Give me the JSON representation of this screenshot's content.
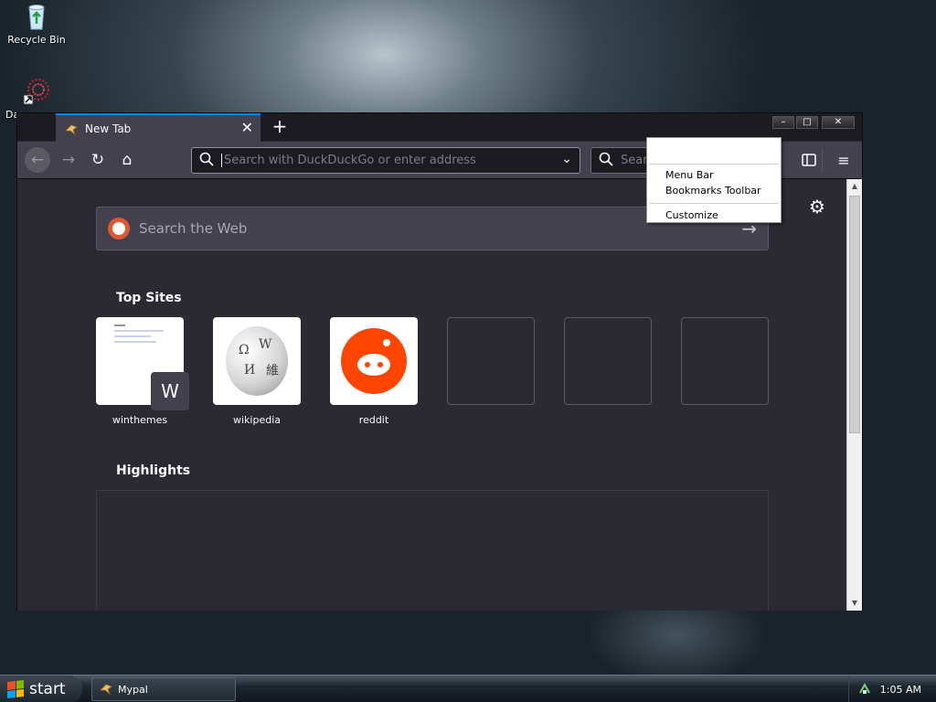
{
  "desktop": {
    "icons": [
      {
        "label": "Recycle Bin"
      },
      {
        "label": "Da"
      }
    ]
  },
  "browser": {
    "tab": {
      "title": "New Tab"
    },
    "window_controls": {
      "minimize": "–",
      "maximize": "□",
      "close": "✕"
    },
    "nav": {
      "back": "←",
      "forward": "→",
      "reload": "↻",
      "home": "⌂"
    },
    "urlbar": {
      "placeholder": "Search with DuckDuckGo or enter address"
    },
    "searchbar": {
      "placeholder": "Search"
    },
    "newtab": {
      "web_search_placeholder": "Search the Web",
      "top_sites_title": "Top Sites",
      "top_sites": [
        {
          "label": "winthemes",
          "badge": "W"
        },
        {
          "label": "wikipedia"
        },
        {
          "label": "reddit"
        },
        {
          "label": ""
        },
        {
          "label": ""
        },
        {
          "label": ""
        }
      ],
      "highlights_title": "Highlights"
    },
    "context_menu": {
      "items": [
        "Menu Bar",
        "Bookmarks Toolbar",
        "Customize"
      ]
    }
  },
  "taskbar": {
    "start_label": "start",
    "task_item": "Mypal",
    "clock": "1:05 AM"
  },
  "colors": {
    "accent": "#0a84ff",
    "toolbar": "#42414d",
    "content_bg": "#2b2a33",
    "reddit": "#ff4500",
    "ddg": "#de5833"
  }
}
